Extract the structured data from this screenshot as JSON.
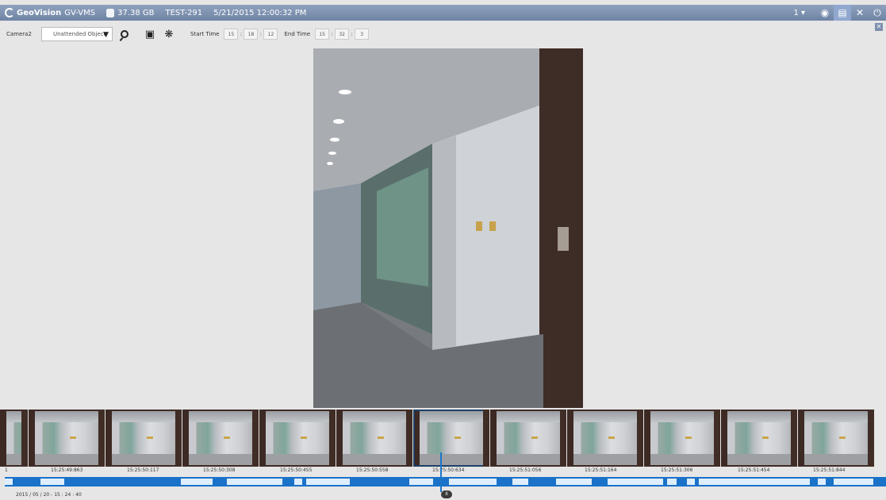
{
  "titlebar": {
    "brand": "GeoVision",
    "app": "GV-VMS",
    "storage": "37.38 GB",
    "host": "TEST-291",
    "datetime": "5/21/2015 12:00:32 PM",
    "layout_select": "1 ▾"
  },
  "toolbar": {
    "camera_label": "Camera2",
    "object_type": "Unattended Object",
    "start_label": "Start Time",
    "start_time": [
      "15",
      "18",
      "12"
    ],
    "end_label": "End Time",
    "end_time": [
      "15",
      "32",
      "3"
    ]
  },
  "thumbnails": {
    "stamps": [
      "1",
      "15:25:49:863",
      "15:25:50:117",
      "15:25:50:308",
      "15:25:50:455",
      "15:25:50:558",
      "15:25:50:634",
      "15:25:51:056",
      "15:25:51:164",
      "15:25:51:306",
      "15:25:51:454",
      "15:25:51:844"
    ],
    "selected_index": 5
  },
  "timeline": {
    "date": "2015 / 05 / 20 - 15 : 24 : 40"
  }
}
